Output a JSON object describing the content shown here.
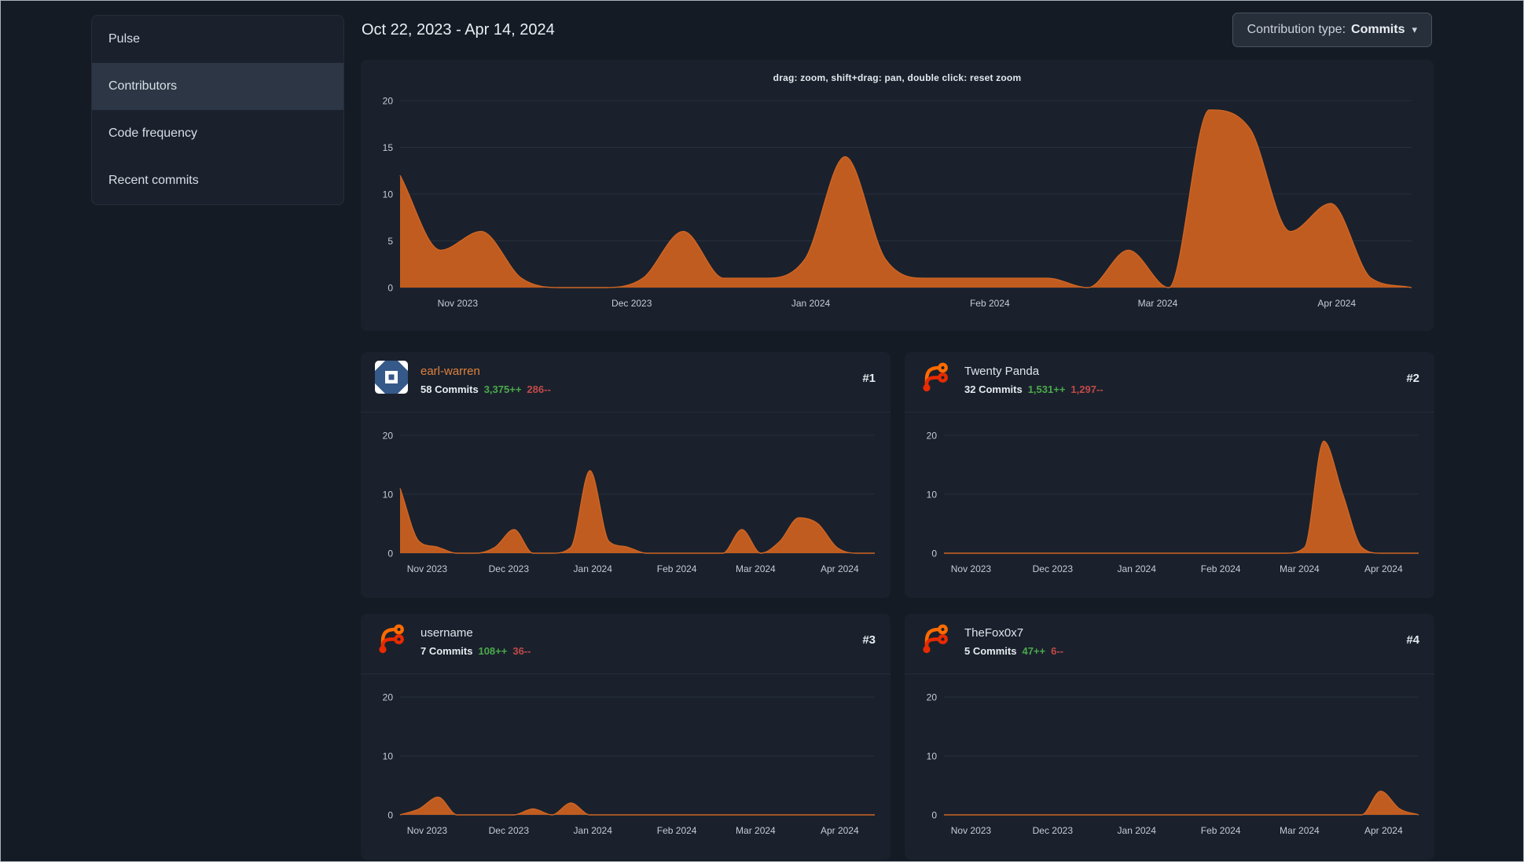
{
  "sidebar": {
    "items": [
      {
        "label": "Pulse",
        "active": false
      },
      {
        "label": "Contributors",
        "active": true
      },
      {
        "label": "Code frequency",
        "active": false
      },
      {
        "label": "Recent commits",
        "active": false
      }
    ]
  },
  "header": {
    "date_range": "Oct 22, 2023 - Apr 14, 2024",
    "contribution_type_label": "Contribution type:",
    "contribution_type_value": "Commits",
    "dropdown_caret": "▾"
  },
  "colors": {
    "page_background": "#151b24",
    "panel_background": "#1a212c",
    "chart_fill_orange": "#c05c20",
    "additions_green": "#4ba94b",
    "deletions_red": "#c14949",
    "highlight_link_orange": "#e0813e",
    "text_primary": "#e9eef4"
  },
  "chart_data": [
    {
      "name": "overall-contributions",
      "type": "area",
      "hint": "drag: zoom, shift+drag: pan, double click: reset zoom",
      "x_start": "2023-10-22",
      "x_end": "2024-04-14",
      "x_interval": "weekly",
      "x_tick_labels": [
        "Nov 2023",
        "Dec 2023",
        "Jan 2024",
        "Feb 2024",
        "Mar 2024",
        "Apr 2024"
      ],
      "x_tick_fractions": [
        0.057,
        0.229,
        0.406,
        0.583,
        0.749,
        0.926
      ],
      "ylim": [
        0,
        20
      ],
      "y_ticks": [
        0,
        5,
        10,
        15,
        20
      ],
      "values": [
        12,
        4,
        6,
        1,
        0,
        0,
        1,
        6,
        1,
        1,
        3,
        14,
        3,
        1,
        1,
        1,
        1,
        0,
        4,
        0,
        19,
        17,
        6,
        9,
        1,
        0
      ],
      "fill_color": "#c05c20",
      "line_color": "#d06524",
      "grid": true,
      "legend": "none"
    },
    {
      "name": "earl-warren-commits",
      "type": "area",
      "x_tick_labels": [
        "Nov 2023",
        "Dec 2023",
        "Jan 2024",
        "Feb 2024",
        "Mar 2024",
        "Apr 2024"
      ],
      "x_tick_fractions": [
        0.057,
        0.229,
        0.406,
        0.583,
        0.749,
        0.926
      ],
      "ylim": [
        0,
        20
      ],
      "y_ticks": [
        0,
        10,
        20
      ],
      "values": [
        11,
        2,
        1,
        0,
        0,
        1,
        4,
        0,
        0,
        1,
        14,
        2,
        1,
        0,
        0,
        0,
        0,
        0,
        4,
        0,
        2,
        6,
        5,
        1,
        0,
        0
      ],
      "fill_color": "#c05c20",
      "line_color": "#d06524",
      "grid": true,
      "legend": "none"
    },
    {
      "name": "twenty-panda-commits",
      "type": "area",
      "x_tick_labels": [
        "Nov 2023",
        "Dec 2023",
        "Jan 2024",
        "Feb 2024",
        "Mar 2024",
        "Apr 2024"
      ],
      "x_tick_fractions": [
        0.057,
        0.229,
        0.406,
        0.583,
        0.749,
        0.926
      ],
      "ylim": [
        0,
        20
      ],
      "y_ticks": [
        0,
        10,
        20
      ],
      "values": [
        0,
        0,
        0,
        0,
        0,
        0,
        0,
        0,
        0,
        0,
        0,
        0,
        0,
        0,
        0,
        0,
        0,
        0,
        0,
        1,
        19,
        10,
        1,
        0,
        0,
        0
      ],
      "fill_color": "#c05c20",
      "line_color": "#d06524",
      "grid": true,
      "legend": "none"
    },
    {
      "name": "username-commits",
      "type": "area",
      "x_tick_labels": [
        "Nov 2023",
        "Dec 2023",
        "Jan 2024",
        "Feb 2024",
        "Mar 2024",
        "Apr 2024"
      ],
      "x_tick_fractions": [
        0.057,
        0.229,
        0.406,
        0.583,
        0.749,
        0.926
      ],
      "ylim": [
        0,
        20
      ],
      "y_ticks": [
        0,
        10,
        20
      ],
      "values": [
        0,
        1,
        3,
        0,
        0,
        0,
        0,
        1,
        0,
        2,
        0,
        0,
        0,
        0,
        0,
        0,
        0,
        0,
        0,
        0,
        0,
        0,
        0,
        0,
        0,
        0
      ],
      "fill_color": "#c05c20",
      "line_color": "#d06524",
      "grid": true,
      "legend": "none"
    },
    {
      "name": "thefox0x7-commits",
      "type": "area",
      "x_tick_labels": [
        "Nov 2023",
        "Dec 2023",
        "Jan 2024",
        "Feb 2024",
        "Mar 2024",
        "Apr 2024"
      ],
      "x_tick_fractions": [
        0.057,
        0.229,
        0.406,
        0.583,
        0.749,
        0.926
      ],
      "ylim": [
        0,
        20
      ],
      "y_ticks": [
        0,
        10,
        20
      ],
      "values": [
        0,
        0,
        0,
        0,
        0,
        0,
        0,
        0,
        0,
        0,
        0,
        0,
        0,
        0,
        0,
        0,
        0,
        0,
        0,
        0,
        0,
        0,
        0,
        4,
        1,
        0
      ],
      "fill_color": "#c05c20",
      "line_color": "#d06524",
      "grid": true,
      "legend": "none"
    }
  ],
  "contributors": [
    {
      "rank": "#1",
      "name": "earl-warren",
      "commits": "58 Commits",
      "additions": "3,375++",
      "deletions": "286--",
      "name_color": "#e0813e",
      "avatar": "identicon-blue-white"
    },
    {
      "rank": "#2",
      "name": "Twenty Panda",
      "commits": "32 Commits",
      "additions": "1,531++",
      "deletions": "1,297--",
      "name_color": "#dfe5ed",
      "avatar": "forgejo-logo"
    },
    {
      "rank": "#3",
      "name": "username",
      "commits": "7 Commits",
      "additions": "108++",
      "deletions": "36--",
      "name_color": "#dfe5ed",
      "avatar": "forgejo-logo"
    },
    {
      "rank": "#4",
      "name": "TheFox0x7",
      "commits": "5 Commits",
      "additions": "47++",
      "deletions": "6--",
      "name_color": "#dfe5ed",
      "avatar": "forgejo-logo"
    }
  ]
}
